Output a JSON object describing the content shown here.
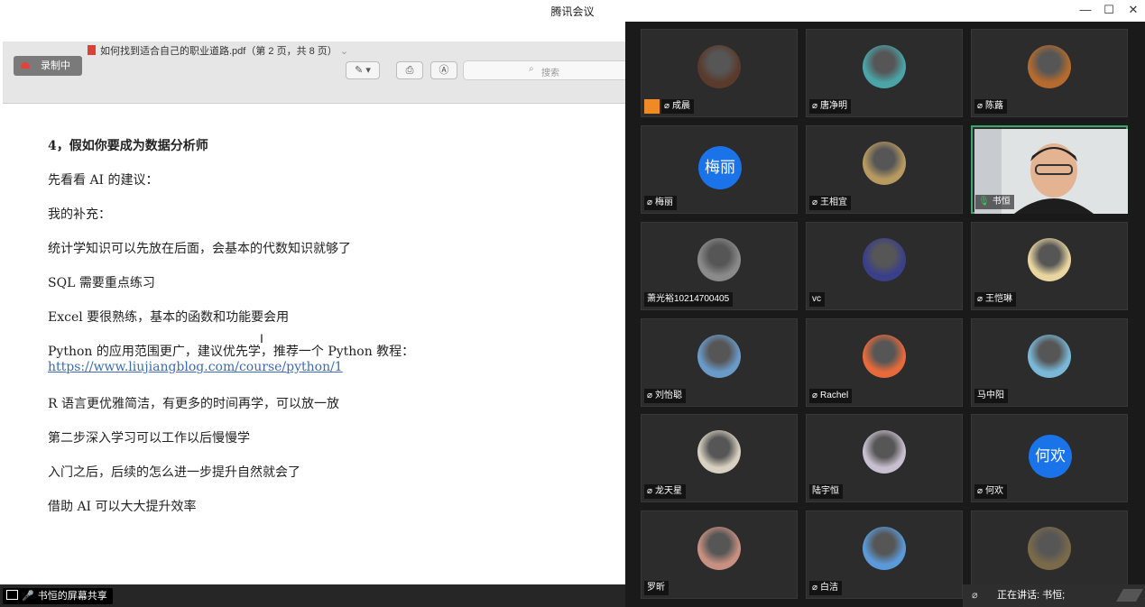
{
  "window": {
    "title": "腾讯会议",
    "minimize": "—",
    "maximize": "☐",
    "close": "✕"
  },
  "viewer": {
    "pdf_title": "如何找到适合自己的职业道路.pdf（第 2 页，共 8 页）",
    "recording_label": "录制中",
    "search_placeholder": "搜索",
    "tools": [
      "✎ ▾",
      "⎙",
      "Ⓐ"
    ]
  },
  "document": {
    "heading": "4，假如你要成为数据分析师",
    "lines": [
      "先看看 AI 的建议：",
      "我的补充：",
      "统计学知识可以先放在后面，会基本的代数知识就够了",
      "SQL 需要重点练习",
      "Excel 要很熟练，基本的函数和功能要会用",
      "Python 的应用范围更广，建议优先学，推荐一个 Python 教程："
    ],
    "link": "https://www.liujiangblog.com/course/python/1",
    "lines2": [
      "R 语言更优雅简洁，有更多的时间再学，可以放一放",
      "第二步深入学习可以工作以后慢慢学",
      "入门之后，后续的怎么进一步提升自然就会了",
      "借助 AI 可以大大提升效率"
    ]
  },
  "share_label": "书恒的屏幕共享",
  "speaking": "正在讲话: 书恒;",
  "participants": [
    {
      "name": "成晨",
      "muted": true,
      "host": true,
      "avatar": "dark-figure-avatar",
      "color": "#5a3a2a"
    },
    {
      "name": "唐净明",
      "muted": true,
      "avatar": "tiger-avatar",
      "color": "#4aa4a8"
    },
    {
      "name": "陈蕗",
      "muted": true,
      "avatar": "cartoon-glasses-avatar",
      "color": "#b56a2e"
    },
    {
      "name": "梅丽",
      "muted": true,
      "initials": "梅丽",
      "color": "#1a73e8"
    },
    {
      "name": "王相宜",
      "muted": true,
      "avatar": "food-bowl-avatar",
      "color": "#b89a60"
    },
    {
      "name": "书恒",
      "speaking": true,
      "video": true
    },
    {
      "name": "萧光裕10214700405",
      "muted": false,
      "avatar": "headphones-avatar",
      "color": "#8a8a8a"
    },
    {
      "name": "vc",
      "muted": false,
      "avatar": "bunny-avatar",
      "color": "#3a3f8a"
    },
    {
      "name": "王恺琳",
      "muted": true,
      "avatar": "anime-boy-avatar",
      "color": "#e8d5a0"
    },
    {
      "name": "刘怡聪",
      "muted": true,
      "avatar": "bird-sky-avatar",
      "color": "#6a9ac8"
    },
    {
      "name": "Rachel",
      "muted": true,
      "avatar": "cartoon-girl-avatar",
      "color": "#e86a3a"
    },
    {
      "name": "马中阳",
      "muted": false,
      "avatar": "fox-avatar",
      "color": "#7ab8d8"
    },
    {
      "name": "龙天星",
      "muted": true,
      "avatar": "duck-avatar",
      "color": "#d8d0c0"
    },
    {
      "name": "陆宇恒",
      "muted": false,
      "avatar": "sketch-avatar",
      "color": "#c8c0d0"
    },
    {
      "name": "何欢",
      "muted": true,
      "initials": "何欢",
      "color": "#1a73e8"
    },
    {
      "name": "罗昕",
      "muted": false,
      "avatar": "portrait-avatar",
      "color": "#c89080"
    },
    {
      "name": "白洁",
      "muted": true,
      "avatar": "beach-avatar",
      "color": "#5a9ad8"
    },
    {
      "name": "",
      "muted": false,
      "avatar": "landscape-avatar",
      "color": "#7a6a4a"
    }
  ]
}
